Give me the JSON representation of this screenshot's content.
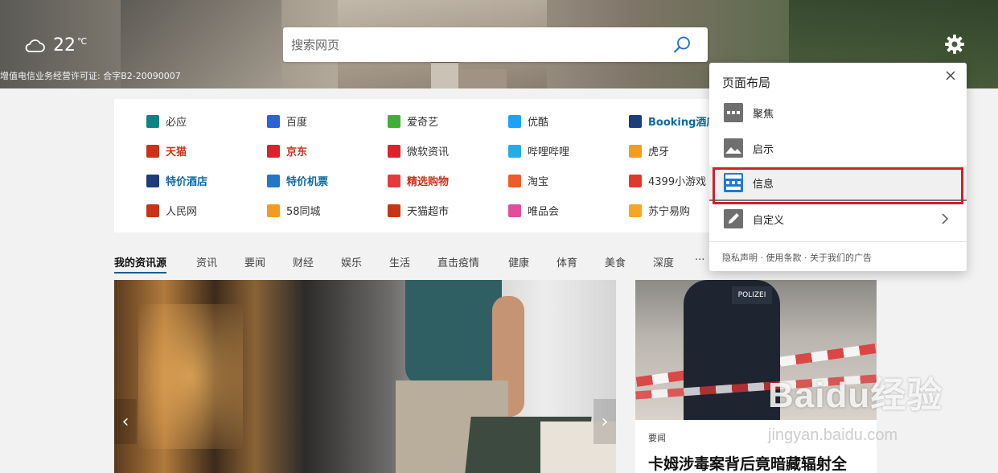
{
  "weather": {
    "icon": "cloud-icon",
    "temp": "22",
    "unit": "℃"
  },
  "license": "增值电信业务经营许可证: 合字B2-20090007",
  "search": {
    "placeholder": "搜索网页",
    "icon": "search-icon"
  },
  "settings": {
    "icon": "gear-icon"
  },
  "quick_links": [
    {
      "label": "必应",
      "style": "normal",
      "icon": "bing-icon",
      "color": "#0c8484"
    },
    {
      "label": "百度",
      "style": "normal",
      "icon": "baidu-icon",
      "color": "#2b62d9"
    },
    {
      "label": "爱奇艺",
      "style": "normal",
      "icon": "iqiyi-icon",
      "color": "#3db135"
    },
    {
      "label": "优酷",
      "style": "normal",
      "icon": "youku-icon",
      "color": "#1aa3ff"
    },
    {
      "label": "Booking酒店",
      "style": "blue",
      "icon": "booking-icon",
      "color": "#1b3d7a"
    },
    {
      "label": "天猫",
      "style": "red",
      "icon": "tmall-icon",
      "color": "#c9331a"
    },
    {
      "label": "京东",
      "style": "red",
      "icon": "jd-icon",
      "color": "#d8242e"
    },
    {
      "label": "微软资讯",
      "style": "normal",
      "icon": "msn-icon",
      "color": "#d8242e"
    },
    {
      "label": "哔哩哔哩",
      "style": "normal",
      "icon": "bilibili-icon",
      "color": "#23ade5"
    },
    {
      "label": "虎牙",
      "style": "normal",
      "icon": "huya-icon",
      "color": "#f39c1f"
    },
    {
      "label": "特价酒店",
      "style": "blue",
      "icon": "hotel-icon",
      "color": "#1b3d7a"
    },
    {
      "label": "特价机票",
      "style": "blue",
      "icon": "flight-icon",
      "color": "#2476c9"
    },
    {
      "label": "精选购物",
      "style": "orange",
      "icon": "shopping-icon",
      "color": "#e23c3c"
    },
    {
      "label": "淘宝",
      "style": "normal",
      "icon": "taobao-icon",
      "color": "#f25b25"
    },
    {
      "label": "4399小游戏",
      "style": "normal",
      "icon": "4399-icon",
      "color": "#e0392b"
    },
    {
      "label": "人民网",
      "style": "normal",
      "icon": "people-icon",
      "color": "#c9331a"
    },
    {
      "label": "58同城",
      "style": "normal",
      "icon": "58-icon",
      "color": "#f39c1f"
    },
    {
      "label": "天猫超市",
      "style": "normal",
      "icon": "tmall-market-icon",
      "color": "#c9331a"
    },
    {
      "label": "唯品会",
      "style": "normal",
      "icon": "vip-icon",
      "color": "#e34e9c"
    },
    {
      "label": "苏宁易购",
      "style": "normal",
      "icon": "suning-icon",
      "color": "#f5a623"
    }
  ],
  "tabs": [
    "我的资讯源",
    "资讯",
    "要闻",
    "财经",
    "娱乐",
    "生活",
    "直击疫情",
    "健康",
    "体育",
    "美食",
    "深度",
    "···"
  ],
  "main_card": {
    "prev": "‹",
    "next": "›"
  },
  "side_card": {
    "badge": "POLIZEI",
    "category": "要闻",
    "headline": "卡姆涉毒案背后竟暗藏辐射全"
  },
  "watermark": {
    "main": "Baidu经验",
    "sub": "jingyan.baidu.com"
  },
  "layout_panel": {
    "title": "页面布局",
    "options": [
      {
        "label": "聚焦",
        "icon": "focus-layout-icon"
      },
      {
        "label": "启示",
        "icon": "inspiration-layout-icon"
      },
      {
        "label": "信息",
        "icon": "informational-layout-icon"
      },
      {
        "label": "自定义",
        "icon": "custom-layout-icon"
      }
    ],
    "footer": "隐私声明 · 使用条款 · 关于我们的广告"
  }
}
